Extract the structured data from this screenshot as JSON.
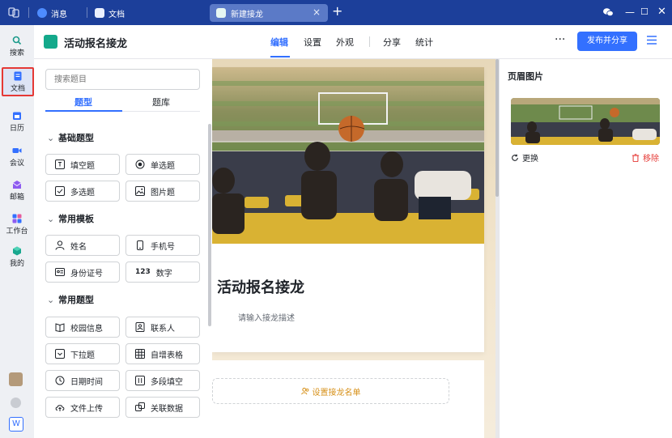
{
  "titlebar": {
    "tabs": [
      {
        "label": "消息"
      },
      {
        "label": "文档"
      }
    ],
    "active_tab": {
      "label": "新建接龙"
    }
  },
  "leftnav": {
    "items": [
      {
        "label": "搜索"
      },
      {
        "label": "文档"
      },
      {
        "label": "日历"
      },
      {
        "label": "会议"
      },
      {
        "label": "邮箱"
      },
      {
        "label": "工作台"
      },
      {
        "label": "我的"
      }
    ],
    "bottom_badge": "W"
  },
  "header": {
    "title": "活动报名接龙",
    "tabs": [
      "编辑",
      "设置",
      "外观",
      "分享",
      "统计"
    ],
    "more": "···",
    "publish_label": "发布并分享"
  },
  "question_panel": {
    "search_placeholder": "搜索题目",
    "tabs": [
      "题型",
      "题库"
    ],
    "sections": [
      {
        "title": "基础题型",
        "items": [
          "填空题",
          "单选题",
          "多选题",
          "图片题"
        ]
      },
      {
        "title": "常用模板",
        "items": [
          "姓名",
          "手机号",
          "身份证号",
          "数字"
        ]
      },
      {
        "title": "常用题型",
        "items": [
          "校园信息",
          "联系人",
          "下拉题",
          "自增表格",
          "日期时间",
          "多段填空",
          "文件上传",
          "关联数据"
        ]
      }
    ]
  },
  "canvas": {
    "form_title": "活动报名接龙",
    "form_desc": "请输入接龙描述",
    "namelist_label": "设置接龙名单"
  },
  "right_panel": {
    "title": "页眉图片",
    "replace_label": "更换",
    "remove_label": "移除"
  },
  "colors": {
    "titlebar": "#1c3f9a",
    "accent": "#3370ff",
    "danger": "#e53935",
    "namelist": "#d7911a"
  }
}
